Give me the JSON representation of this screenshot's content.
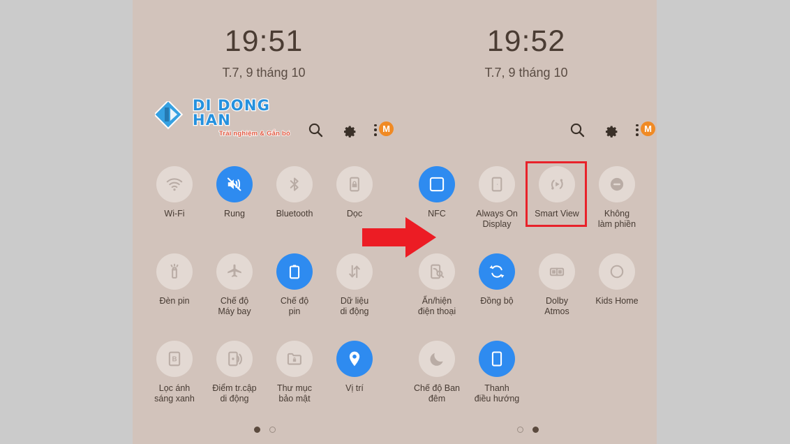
{
  "colors": {
    "page_background": "#cbcbcb",
    "phone_background": "#d2c3bb",
    "tile_inactive": "#e3d9d3",
    "tile_active": "#2e8bf0",
    "annotation_red": "#e8222a",
    "badge_orange": "#f08a24",
    "logo_blue": "#1e8fe0",
    "logo_red": "#e2533a"
  },
  "watermark": {
    "title": "DI DONG HAN",
    "subtitle": "Trải nghiệm & Gắn bó",
    "mark_icon": "diamond-logo-icon"
  },
  "panels": [
    {
      "id": "left",
      "clock": {
        "time": "19:51",
        "date": "T.7, 9 tháng 10"
      },
      "header": {
        "search_icon": "search-icon",
        "settings_icon": "gear-icon",
        "menu_icon": "three-dots-menu-icon",
        "badge_label": "M"
      },
      "tiles": [
        {
          "label": "Wi-Fi",
          "icon": "wifi-icon",
          "active": false
        },
        {
          "label": "Rung",
          "icon": "vibrate-icon",
          "active": true
        },
        {
          "label": "Bluetooth",
          "icon": "bluetooth-icon",
          "active": false
        },
        {
          "label": "Dọc",
          "icon": "rotation-lock-icon",
          "active": false
        },
        {
          "label": "Đèn pin",
          "icon": "flashlight-icon",
          "active": false
        },
        {
          "label": "Chế độ\nMáy bay",
          "icon": "airplane-icon",
          "active": false
        },
        {
          "label": "Chế độ\npin",
          "icon": "power-saving-icon",
          "active": true
        },
        {
          "label": "Dữ liệu\ndi động",
          "icon": "mobile-data-icon",
          "active": false
        },
        {
          "label": "Lọc ánh\nsáng xanh",
          "icon": "blue-light-filter-icon",
          "active": false
        },
        {
          "label": "Điểm tr.cập\ndi động",
          "icon": "hotspot-icon",
          "active": false
        },
        {
          "label": "Thư mục\nbảo mật",
          "icon": "secure-folder-icon",
          "active": false
        },
        {
          "label": "Vị trí",
          "icon": "location-pin-icon",
          "active": true
        }
      ],
      "page_dots": {
        "count": 2,
        "active_index": 0
      }
    },
    {
      "id": "right",
      "clock": {
        "time": "19:52",
        "date": "T.7, 9 tháng 10"
      },
      "header": {
        "search_icon": "search-icon",
        "settings_icon": "gear-icon",
        "menu_icon": "three-dots-menu-icon",
        "badge_label": "M"
      },
      "tiles": [
        {
          "label": "NFC",
          "icon": "nfc-icon",
          "active": true
        },
        {
          "label": "Always On\nDisplay",
          "icon": "always-on-display-icon",
          "active": false
        },
        {
          "label": "Smart View",
          "icon": "smart-view-icon",
          "active": false,
          "highlighted": true
        },
        {
          "label": "Không\nlàm phiền",
          "icon": "do-not-disturb-icon",
          "active": false
        },
        {
          "label": "Ẩn/hiện\nđiện thoại",
          "icon": "find-my-phone-icon",
          "active": false
        },
        {
          "label": "Đồng bộ",
          "icon": "sync-icon",
          "active": true
        },
        {
          "label": "Dolby\nAtmos",
          "icon": "dolby-atmos-icon",
          "active": false
        },
        {
          "label": "Kids Home",
          "icon": "kids-home-icon",
          "active": false
        },
        {
          "label": "Chế độ Ban\nđêm",
          "icon": "night-mode-moon-icon",
          "active": false
        },
        {
          "label": "Thanh\nđiều hướng",
          "icon": "navigation-bar-icon",
          "active": true
        }
      ],
      "page_dots": {
        "count": 2,
        "active_index": 1
      }
    }
  ],
  "annotations": {
    "arrow": {
      "name": "red-arrow-annotation",
      "direction": "right"
    },
    "highlight_box": {
      "name": "smart-view-highlight-box",
      "target": "Smart View"
    }
  }
}
